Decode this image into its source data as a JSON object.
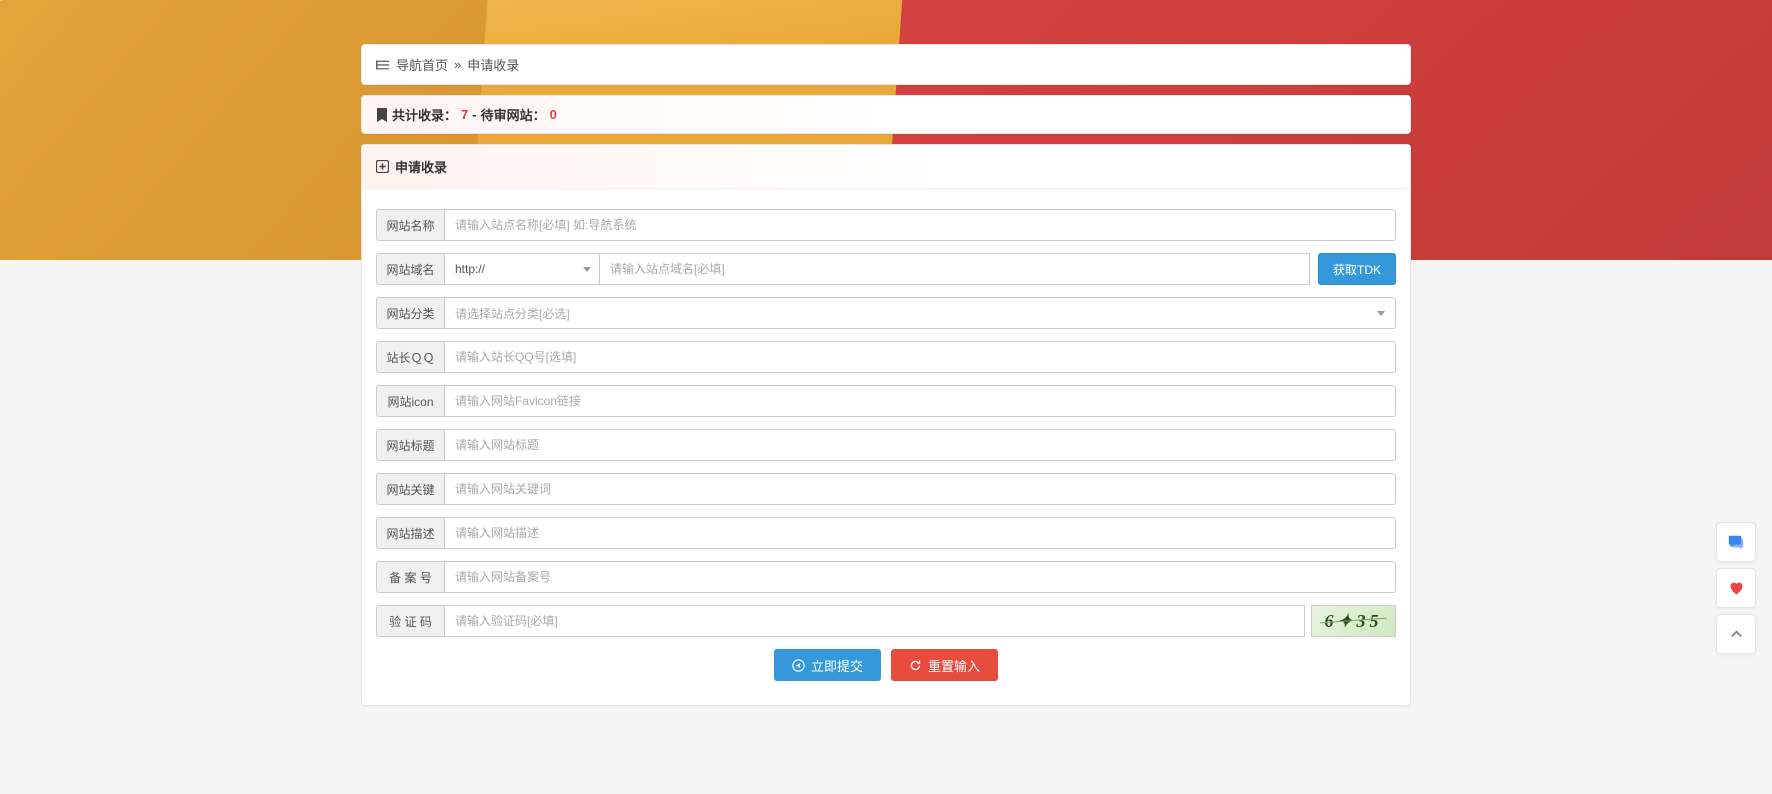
{
  "breadcrumb": {
    "home": "导航首页",
    "sep": "»",
    "current": "申请收录"
  },
  "stats": {
    "total_label": "共计收录：",
    "total_value": "7",
    "sep": " - ",
    "pending_label": "待审网站：",
    "pending_value": "0"
  },
  "form": {
    "title": "申请收录",
    "labels": {
      "site_name": "网站名称",
      "domain": "网站域名",
      "category": "网站分类",
      "qq": "站长ＱＱ",
      "icon": "网站icon",
      "title_field": "网站标题",
      "keywords": "网站关键",
      "description": "网站描述",
      "beian": "备 案 号",
      "captcha": "验 证 码"
    },
    "placeholders": {
      "site_name": "请输入站点名称[必填] 如:导航系统",
      "domain": "请输入站点域名[必填]",
      "category": "请选择站点分类[必选]",
      "qq": "请输入站长QQ号[选填]",
      "icon": "请输入网站Favicon链接",
      "title_field": "请输入网站标题",
      "keywords": "请输入网站关键词",
      "description": "请输入网站描述",
      "beian": "请输入网站备案号",
      "captcha": "请输入验证码[必填]"
    },
    "protocol": "http://",
    "btn_tdk": "获取TDK",
    "btn_submit": "立即提交",
    "btn_reset": "重置输入",
    "captcha_text": "6✦35"
  }
}
